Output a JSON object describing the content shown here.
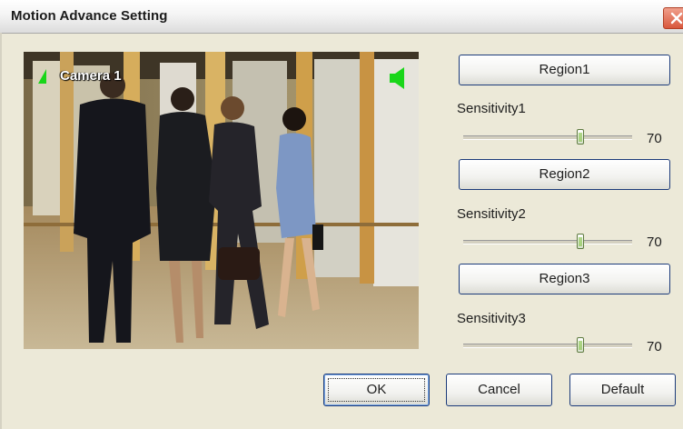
{
  "window": {
    "title": "Motion Advance Setting"
  },
  "video": {
    "camera_label": "Camera 1"
  },
  "regions": [
    {
      "button_label": "Region1",
      "sensitivity_label": "Sensitivity1",
      "value": "70",
      "slider_fraction": 0.7
    },
    {
      "button_label": "Region2",
      "sensitivity_label": "Sensitivity2",
      "value": "70",
      "slider_fraction": 0.7
    },
    {
      "button_label": "Region3",
      "sensitivity_label": "Sensitivity3",
      "value": "70",
      "slider_fraction": 0.7
    }
  ],
  "footer": {
    "ok_label": "OK",
    "cancel_label": "Cancel",
    "default_label": "Default"
  },
  "icons": {
    "close": "close-icon",
    "speaker": "speaker-icon",
    "camera_marker": "camera-flag-icon"
  },
  "colors": {
    "close_button": "#d8573c",
    "marker_green": "#19d619",
    "button_border": "#1c3b7a"
  }
}
